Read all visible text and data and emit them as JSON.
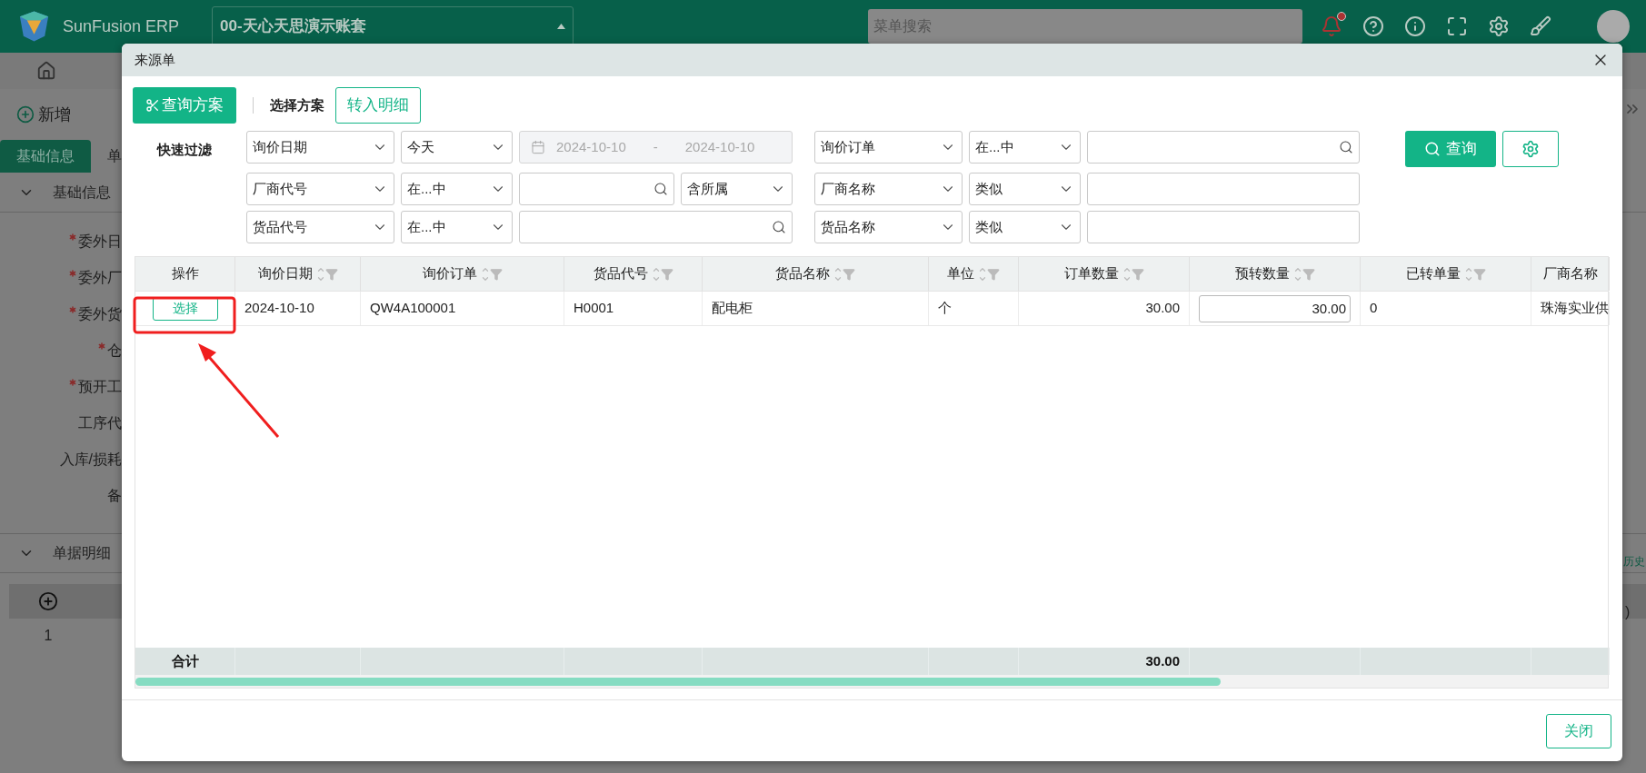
{
  "topbar": {
    "logo_text": "SunFusion ERP",
    "account": "00-天心天思演示账套",
    "search": {
      "placeholder": "菜单搜索"
    }
  },
  "background": {
    "add_button": "新增",
    "tabs": [
      {
        "label": "基础信息",
        "selected": true
      },
      {
        "label": "单",
        "selected": false
      }
    ],
    "section_title": "基础信息",
    "fields": [
      {
        "label": "委外日",
        "required": true
      },
      {
        "label": "委外厂",
        "required": true
      },
      {
        "label": "委外货",
        "required": true
      },
      {
        "label": "仓",
        "required": true
      },
      {
        "label": "预开工",
        "required": true
      },
      {
        "label": "工序代",
        "required": false
      },
      {
        "label": "入库/损耗",
        "required": false
      },
      {
        "label": "备",
        "required": false
      }
    ],
    "detail_section": "单据明细",
    "detail_rows": [
      "1"
    ],
    "history_tab": "历史",
    "column_fragment": ")"
  },
  "dialog": {
    "title": "来源单",
    "scheme_button": "查询方案",
    "scheme_label": "选择方案",
    "transfer_button": "转入明细",
    "filter_label": "快速过滤",
    "query_button": "查询",
    "filter_rows": [
      {
        "left": [
          {
            "kind": "select",
            "value": "询价日期"
          },
          {
            "kind": "select",
            "value": "今天"
          },
          {
            "kind": "date_range",
            "from": "2024-10-10",
            "separator": "-",
            "to": "2024-10-10"
          }
        ],
        "right": [
          {
            "kind": "select",
            "value": "询价订单"
          },
          {
            "kind": "select",
            "value": "在...中"
          },
          {
            "kind": "search"
          }
        ]
      },
      {
        "left": [
          {
            "kind": "select",
            "value": "厂商代号"
          },
          {
            "kind": "select",
            "value": "在...中"
          },
          {
            "kind": "search"
          },
          {
            "kind": "select",
            "value": "含所属"
          }
        ],
        "right": [
          {
            "kind": "select",
            "value": "厂商名称"
          },
          {
            "kind": "select",
            "value": "类似"
          },
          {
            "kind": "text"
          }
        ]
      },
      {
        "left": [
          {
            "kind": "select",
            "value": "货品代号"
          },
          {
            "kind": "select",
            "value": "在...中"
          },
          {
            "kind": "search"
          }
        ],
        "right": [
          {
            "kind": "select",
            "value": "货品名称"
          },
          {
            "kind": "select",
            "value": "类似"
          },
          {
            "kind": "text"
          }
        ]
      }
    ],
    "columns": [
      {
        "label": "操作",
        "kind": "action"
      },
      {
        "label": "询价日期",
        "kind": "text"
      },
      {
        "label": "询价订单",
        "kind": "text"
      },
      {
        "label": "货品代号",
        "kind": "text"
      },
      {
        "label": "货品名称",
        "kind": "text"
      },
      {
        "label": "单位",
        "kind": "text"
      },
      {
        "label": "订单数量",
        "kind": "number",
        "total": "30.00"
      },
      {
        "label": "预转数量",
        "kind": "input"
      },
      {
        "label": "已转单量",
        "kind": "text"
      },
      {
        "label": "厂商名称",
        "kind": "plain"
      }
    ],
    "rows": [
      {
        "cells": [
          "选择",
          "2024-10-10",
          "QW4A100001",
          "H0001",
          "配电柜",
          "个",
          "30.00",
          "30.00",
          "0",
          "珠海实业供"
        ]
      }
    ],
    "total_label": "合计",
    "close_button": "关闭"
  }
}
